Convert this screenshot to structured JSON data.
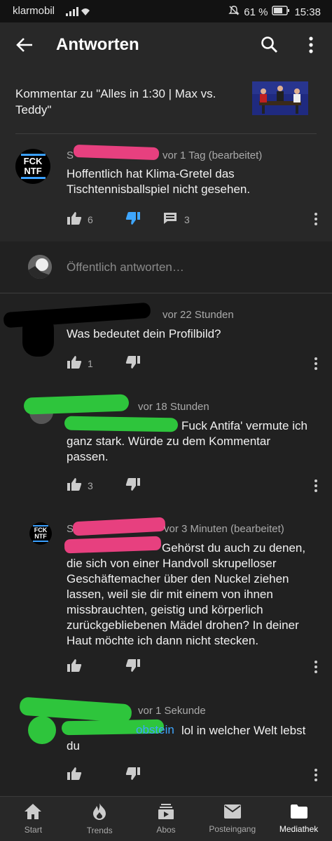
{
  "status_bar": {
    "carrier": "klarmobil",
    "battery": "61 %",
    "time": "15:38"
  },
  "app_bar": {
    "title": "Antworten"
  },
  "video_context": {
    "text": "Kommentar zu \"Alles in 1:30 | Max vs. Teddy\""
  },
  "main_comment": {
    "author_initial": "S",
    "avatar_text_1": "FCK",
    "avatar_text_2": "NTF",
    "meta": "vor 1 Tag (bearbeitet)",
    "text": "Hoffentlich hat Klima-Gretel das Tischtennisballspiel nicht gesehen.",
    "likes": "6",
    "replies": "3"
  },
  "reply_input": {
    "placeholder": "Öffentlich antworten…"
  },
  "replies": [
    {
      "meta": "vor 22 Stunden",
      "text": "Was bedeutet dein Profilbild?",
      "likes": "1"
    },
    {
      "meta": "vor 18 Stunden",
      "text": "Fuck Antifa' vermute ich ganz stark. Würde zu dem Kommentar passen.",
      "likes": "3"
    },
    {
      "author_initial": "S",
      "meta": "vor 3 Minuten (bearbeitet)",
      "text": "Gehörst du auch zu denen, die sich von einer Handvoll skrupelloser Geschäftemacher über den Nuckel ziehen lassen, weil sie dir mit einem von ihnen missbrauchten, geistig und körperlich zurückgebliebenen Mädel drohen? In deiner Haut möchte ich dann nicht stecken.",
      "likes": ""
    },
    {
      "meta": "vor 1 Sekunde",
      "link_tail": "obstein",
      "text": "lol in welcher Welt lebst du",
      "likes": ""
    }
  ],
  "bottom_nav": [
    {
      "label": "Start",
      "icon": "home-icon"
    },
    {
      "label": "Trends",
      "icon": "flame-icon"
    },
    {
      "label": "Abos",
      "icon": "subscriptions-icon"
    },
    {
      "label": "Posteingang",
      "icon": "inbox-icon"
    },
    {
      "label": "Mediathek",
      "icon": "library-icon"
    }
  ],
  "colors": {
    "accent_blue": "#3ea6ff",
    "background": "#212121",
    "pink_redaction": "#e7407f",
    "green_redaction": "#2ec53c"
  }
}
